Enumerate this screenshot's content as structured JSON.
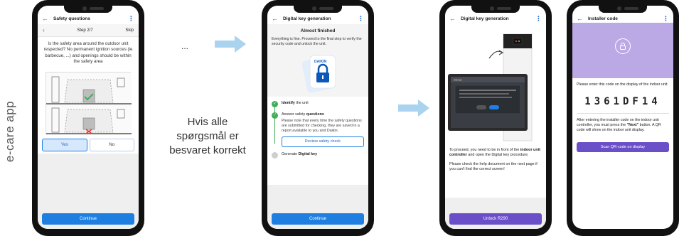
{
  "side_label": "e-care app",
  "ellipsis": "...",
  "mid_text": "Hvis alle spørgsmål er besvaret korrekt",
  "colors": {
    "accent_blue": "#1f7fe0",
    "accent_purple": "#6a4fc8",
    "success_green": "#3fae5a",
    "arrow": "#a9d3ee"
  },
  "phone1": {
    "title": "Safety questions",
    "step": "Step 2/7",
    "skip": "Skip",
    "question": "Is the safety area around the outdoor unit respected? No permanent ignition sources (ie barbecue, ...) and openings should be within the safety area",
    "yes": "Yes",
    "no": "No",
    "continue": "Continue"
  },
  "phone2": {
    "title": "Digital key generation",
    "heading": "Almost finished",
    "subtitle": "Everything is fine. Proceed to the final step to verify the security code and unlock the unit.",
    "brand": "DAIKIN",
    "step1_bold": "Identify",
    "step1_rest": " the unit",
    "step2_pre": "Answer safety ",
    "step2_bold": "questions",
    "step2_note": "Please note that every time the safety questions are submitted for checking, they are saved in a report available to you and Daikin.",
    "review": "Review safety check",
    "step3_pre": "Generate ",
    "step3_bold": "Digital key",
    "continue": "Continue"
  },
  "phone3": {
    "title": "Digital key generation",
    "p1_pre": "To proceed, you need to be in front of the ",
    "p1_bold": "indoor unit controller",
    "p1_post": " and open the Digital key procedure.",
    "p2": "Please check the help document on the next page if you can't find the correct screen!",
    "button": "Unlock R290"
  },
  "phone4": {
    "title": "Installer code",
    "instruction": "Please enter this code on the display of the indoor unit.",
    "code": "1361DF14",
    "after_pre": "After entering the installer code on the indoor unit controller, you must press the ",
    "after_bold": "\"Next\"",
    "after_post": " button. A QR code will show on the indoor unit display.",
    "scan": "Scan QR-code on display"
  }
}
